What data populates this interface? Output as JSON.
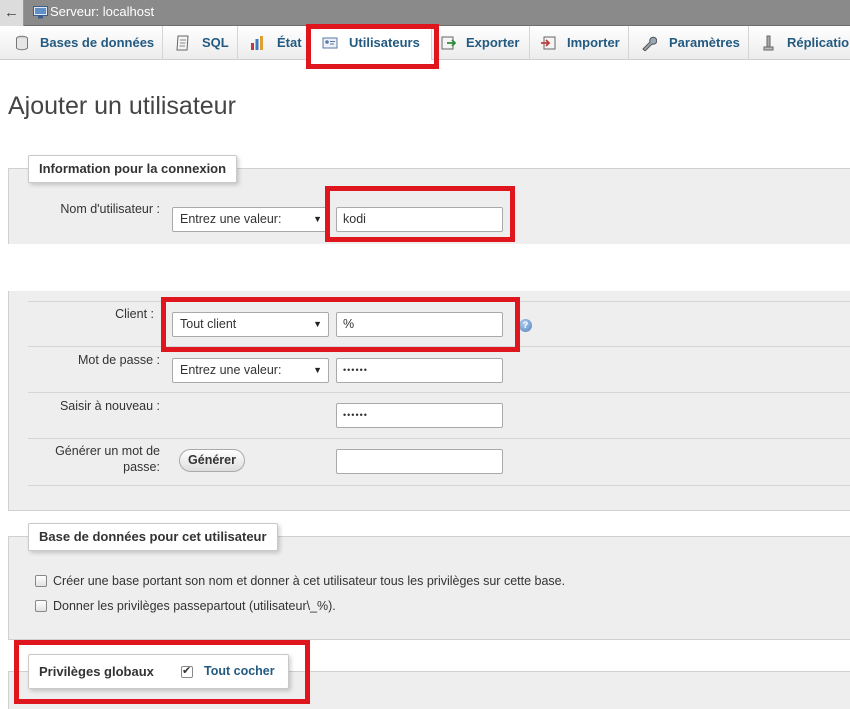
{
  "server_bar": {
    "back_symbol": "←",
    "title": "Serveur: localhost"
  },
  "tabs": [
    {
      "label": "Bases de données",
      "icon": "database-icon"
    },
    {
      "label": "SQL",
      "icon": "sql-icon"
    },
    {
      "label": "État",
      "icon": "status-icon"
    },
    {
      "label": "Utilisateurs",
      "icon": "users-icon"
    },
    {
      "label": "Exporter",
      "icon": "export-icon"
    },
    {
      "label": "Importer",
      "icon": "import-icon"
    },
    {
      "label": "Paramètres",
      "icon": "wrench-icon"
    },
    {
      "label": "Réplication",
      "icon": "replication-icon"
    }
  ],
  "page_title": "Ajouter un utilisateur",
  "login_section": {
    "legend": "Information pour la connexion",
    "username": {
      "label": "Nom d'utilisateur :",
      "mode": "Entrez une valeur:",
      "value": "kodi"
    },
    "client": {
      "label": "Client :",
      "mode": "Tout client",
      "value": "%"
    },
    "password": {
      "label": "Mot de passe :",
      "mode": "Entrez une valeur:",
      "value": "••••••"
    },
    "retype": {
      "label": "Saisir à nouveau :",
      "value": "••••••"
    },
    "generate": {
      "label_line1": "Générer un mot de",
      "label_line2": "passe:",
      "button": "Générer",
      "value": ""
    }
  },
  "database_section": {
    "legend": "Base de données pour cet utilisateur",
    "options": [
      {
        "label": "Créer une base portant son nom et donner à cet utilisateur tous les privilèges sur cette base.",
        "checked": false
      },
      {
        "label": "Donner les privilèges passepartout (utilisateur\\_%).",
        "checked": false
      }
    ]
  },
  "privileges_section": {
    "legend": "Privilèges globaux",
    "check_all": {
      "label": "Tout cocher",
      "checked": true
    }
  },
  "colors": {
    "highlight": "#e0161f",
    "link": "#235a81",
    "panel": "#eeeeee"
  }
}
